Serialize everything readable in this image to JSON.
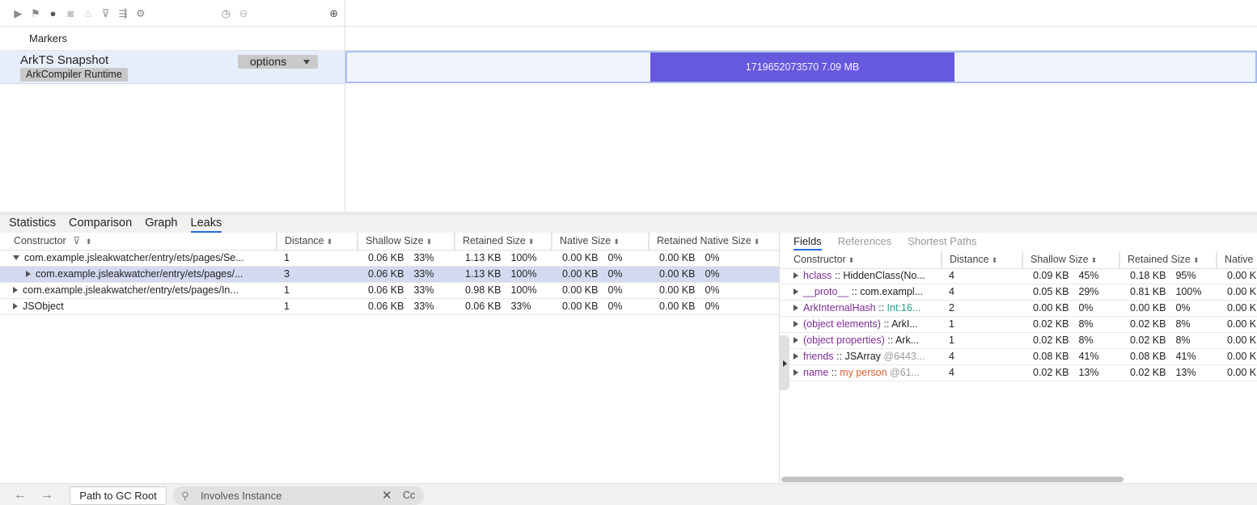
{
  "toolbar": {
    "icons": [
      "play-icon",
      "flag-icon",
      "record-icon",
      "camera-icon",
      "stack-icon",
      "filter-icon",
      "share-icon",
      "gear-icon"
    ],
    "right_icons": [
      "timer-icon",
      "minus-icon",
      "add-icon"
    ]
  },
  "markers": {
    "label": "Markers"
  },
  "snapshot": {
    "title": "ArkTS Snapshot",
    "badge": "ArkCompiler Runtime",
    "options_label": "options",
    "bar_label": "1719652073570 7.09 MB",
    "bar_color": "#6659dd"
  },
  "tabs": [
    {
      "label": "Statistics"
    },
    {
      "label": "Comparison"
    },
    {
      "label": "Graph"
    },
    {
      "label": "Leaks"
    }
  ],
  "active_tab": "Leaks",
  "left_table": {
    "columns": [
      "Constructor",
      "Distance",
      "Shallow Size",
      "Retained Size",
      "Native Size",
      "Retained Native Size"
    ],
    "rows": [
      {
        "name": "com.example.jsleakwatcher/entry/ets/pages/Se...",
        "distance": "1",
        "shallow": "0.06 KB",
        "shallow_pct": "33%",
        "retained": "1.13 KB",
        "retained_pct": "100%",
        "native": "0.00 KB",
        "native_pct": "0%",
        "rnative": "0.00 KB",
        "rnative_pct": "0%"
      },
      {
        "name": "com.example.jsleakwatcher/entry/ets/pages/...",
        "distance": "3",
        "shallow": "0.06 KB",
        "shallow_pct": "33%",
        "retained": "1.13 KB",
        "retained_pct": "100%",
        "native": "0.00 KB",
        "native_pct": "0%",
        "rnative": "0.00 KB",
        "rnative_pct": "0%"
      },
      {
        "name": "com.example.jsleakwatcher/entry/ets/pages/In...",
        "distance": "1",
        "shallow": "0.06 KB",
        "shallow_pct": "33%",
        "retained": "0.98 KB",
        "retained_pct": "100%",
        "native": "0.00 KB",
        "native_pct": "0%",
        "rnative": "0.00 KB",
        "rnative_pct": "0%"
      },
      {
        "name": "JSObject",
        "distance": "1",
        "shallow": "0.06 KB",
        "shallow_pct": "33%",
        "retained": "0.06 KB",
        "retained_pct": "33%",
        "native": "0.00 KB",
        "native_pct": "0%",
        "rnative": "0.00 KB",
        "rnative_pct": "0%"
      }
    ]
  },
  "right_panel": {
    "tabs": [
      "Fields",
      "References",
      "Shortest Paths"
    ],
    "columns": [
      "Constructor",
      "Distance",
      "Shallow Size",
      "Retained Size",
      "Native"
    ],
    "rows": [
      {
        "field": "hclass",
        "sep": " :: ",
        "type": "HiddenClass(No...",
        "distance": "4",
        "shallow": "0.09 KB",
        "shallow_pct": "45%",
        "retained": "0.18 KB",
        "retained_pct": "95%",
        "native": "0.00 K"
      },
      {
        "field": "__proto__",
        "sep": " :: ",
        "type": "com.exampl...",
        "distance": "4",
        "shallow": "0.05 KB",
        "shallow_pct": "29%",
        "retained": "0.81 KB",
        "retained_pct": "100%",
        "native": "0.00 K"
      },
      {
        "field": "ArkInternalHash",
        "sep": " :: ",
        "type": "Int:16...",
        "distance": "2",
        "shallow": "0.00 KB",
        "shallow_pct": "0%",
        "retained": "0.00 KB",
        "retained_pct": "0%",
        "native": "0.00 K"
      },
      {
        "field": "(object elements)",
        "sep": " :: ",
        "type": "ArkI...",
        "distance": "1",
        "shallow": "0.02 KB",
        "shallow_pct": "8%",
        "retained": "0.02 KB",
        "retained_pct": "8%",
        "native": "0.00 K"
      },
      {
        "field": "(object properties)",
        "sep": " :: ",
        "type": "Ark...",
        "distance": "1",
        "shallow": "0.02 KB",
        "shallow_pct": "8%",
        "retained": "0.02 KB",
        "retained_pct": "8%",
        "native": "0.00 K"
      },
      {
        "field": "friends",
        "sep": " :: ",
        "type": "JSArray",
        "addr": " @6443...",
        "distance": "4",
        "shallow": "0.08 KB",
        "shallow_pct": "41%",
        "retained": "0.08 KB",
        "retained_pct": "41%",
        "native": "0.00 K"
      },
      {
        "field": "name",
        "sep": " :: ",
        "type": "my person",
        "addr": " @61...",
        "distance": "4",
        "shallow": "0.02 KB",
        "shallow_pct": "13%",
        "retained": "0.02 KB",
        "retained_pct": "13%",
        "native": "0.00 K"
      }
    ]
  },
  "bottom": {
    "back": "←",
    "forward": "→",
    "gc_button": "Path to GC Root",
    "search_value": "Involves Instance",
    "clear": "✕",
    "case": "Cc"
  }
}
